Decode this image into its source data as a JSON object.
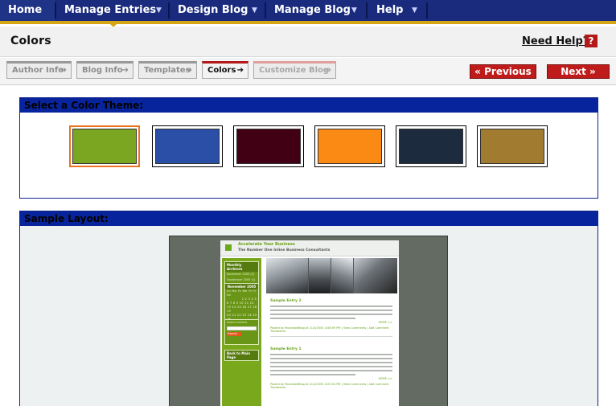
{
  "nav": {
    "items": [
      {
        "label": "Home"
      },
      {
        "label": "Manage Entries"
      },
      {
        "label": "Design Blog"
      },
      {
        "label": "Manage Blog"
      },
      {
        "label": "Help"
      }
    ]
  },
  "header": {
    "title": "Colors",
    "help_label": "Need Help?",
    "help_icon": "?"
  },
  "steps": [
    {
      "label": "Author Info"
    },
    {
      "label": "Blog Info"
    },
    {
      "label": "Templates"
    },
    {
      "label": "Colors"
    },
    {
      "label": "Customize Blog"
    }
  ],
  "buttons": {
    "previous": "« Previous",
    "next": "Next »"
  },
  "color_theme": {
    "heading": "Select a Color Theme:",
    "swatches": [
      {
        "color": "#7aa622",
        "selected": true
      },
      {
        "color": "#2b4ea6",
        "selected": false
      },
      {
        "color": "#420015",
        "selected": false
      },
      {
        "color": "#fb8a14",
        "selected": false
      },
      {
        "color": "#1d2b3f",
        "selected": false
      },
      {
        "color": "#a07b30",
        "selected": false
      }
    ]
  },
  "sample": {
    "heading": "Sample Layout:",
    "blog_title": "Accelerate Your Business",
    "blog_subtitle": "The Number One Inline Business Consultants",
    "monthly_archive_label": "Monthly Archives",
    "archive_1": "November 2005 (2)",
    "archive_2": "September 2005 (1)",
    "calendar_label": "November 2005",
    "calendar_days": "Su Mo Tu We Th Fr Sa",
    "calendar_row_1": "1 2 3 4 5",
    "calendar_row_2": "6 7 8 9 10 11 12",
    "calendar_row_3": "13 14 15 16 17 18 19",
    "calendar_row_4": "20 21 22 23 24 25 26",
    "calendar_row_5": "27 28 29 30",
    "search_label": "Search entries",
    "search_button": "Search",
    "back_link": "Back to Main Page",
    "entry_1_title": "Sample Entry 2",
    "entry_1_more": "MORE >>",
    "entry_1_meta": "Posted by MoveableBlog at 11/4/2005 4:06:59 PM | View Comments | Add Comment",
    "entry_1_trackbacks": "Trackbacks",
    "entry_2_title": "Sample Entry 1",
    "entry_2_more": "MORE >>",
    "entry_2_meta": "Posted by MoveableBlog at 11/4/2005 4:03:34 PM | View Comments | Add Comment",
    "entry_2_trackbacks": "Trackbacks"
  }
}
